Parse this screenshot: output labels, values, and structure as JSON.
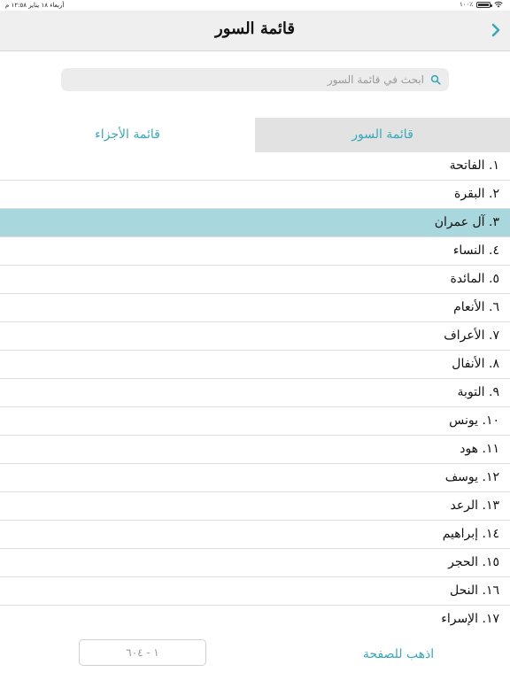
{
  "status_bar": {
    "datetime": "أربعاء ١٨ يناير ١٢:٥٨ م",
    "battery_text": "٪١٠٠",
    "battery_level": 1.0,
    "wifi_icon": "wifi-icon",
    "battery_icon": "battery-icon"
  },
  "header": {
    "title": "قائمة السور",
    "back_icon": "chevron-right-icon"
  },
  "search": {
    "placeholder": "ابحث في قائمة السور",
    "value": "",
    "icon": "search-icon"
  },
  "tabs": {
    "surahs_label": "قائمة السور",
    "juz_label": "قائمة الأجزاء",
    "active": "surahs"
  },
  "surahs": [
    "١. الفاتحة",
    "٢. البقرة",
    "٣. آل عمران",
    "٤. النساء",
    "٥. المائدة",
    "٦. الأنعام",
    "٧. الأعراف",
    "٨. الأنفال",
    "٩. التوبة",
    "١٠. يونس",
    "١١. هود",
    "١٢. يوسف",
    "١٣. الرعد",
    "١٤. إبراهيم",
    "١٥. الحجر",
    "١٦. النحل",
    "١٧. الإسراء"
  ],
  "selected_index": 2,
  "footer": {
    "goto_label": "اذهب للصفحة",
    "page_placeholder": "١ - ٦٠٤",
    "page_value": ""
  },
  "colors": {
    "accent": "#3aa7b9",
    "selected_row": "#a8d8de",
    "nav_background": "#efefef",
    "inactive_tab": "#e2e2e2"
  }
}
